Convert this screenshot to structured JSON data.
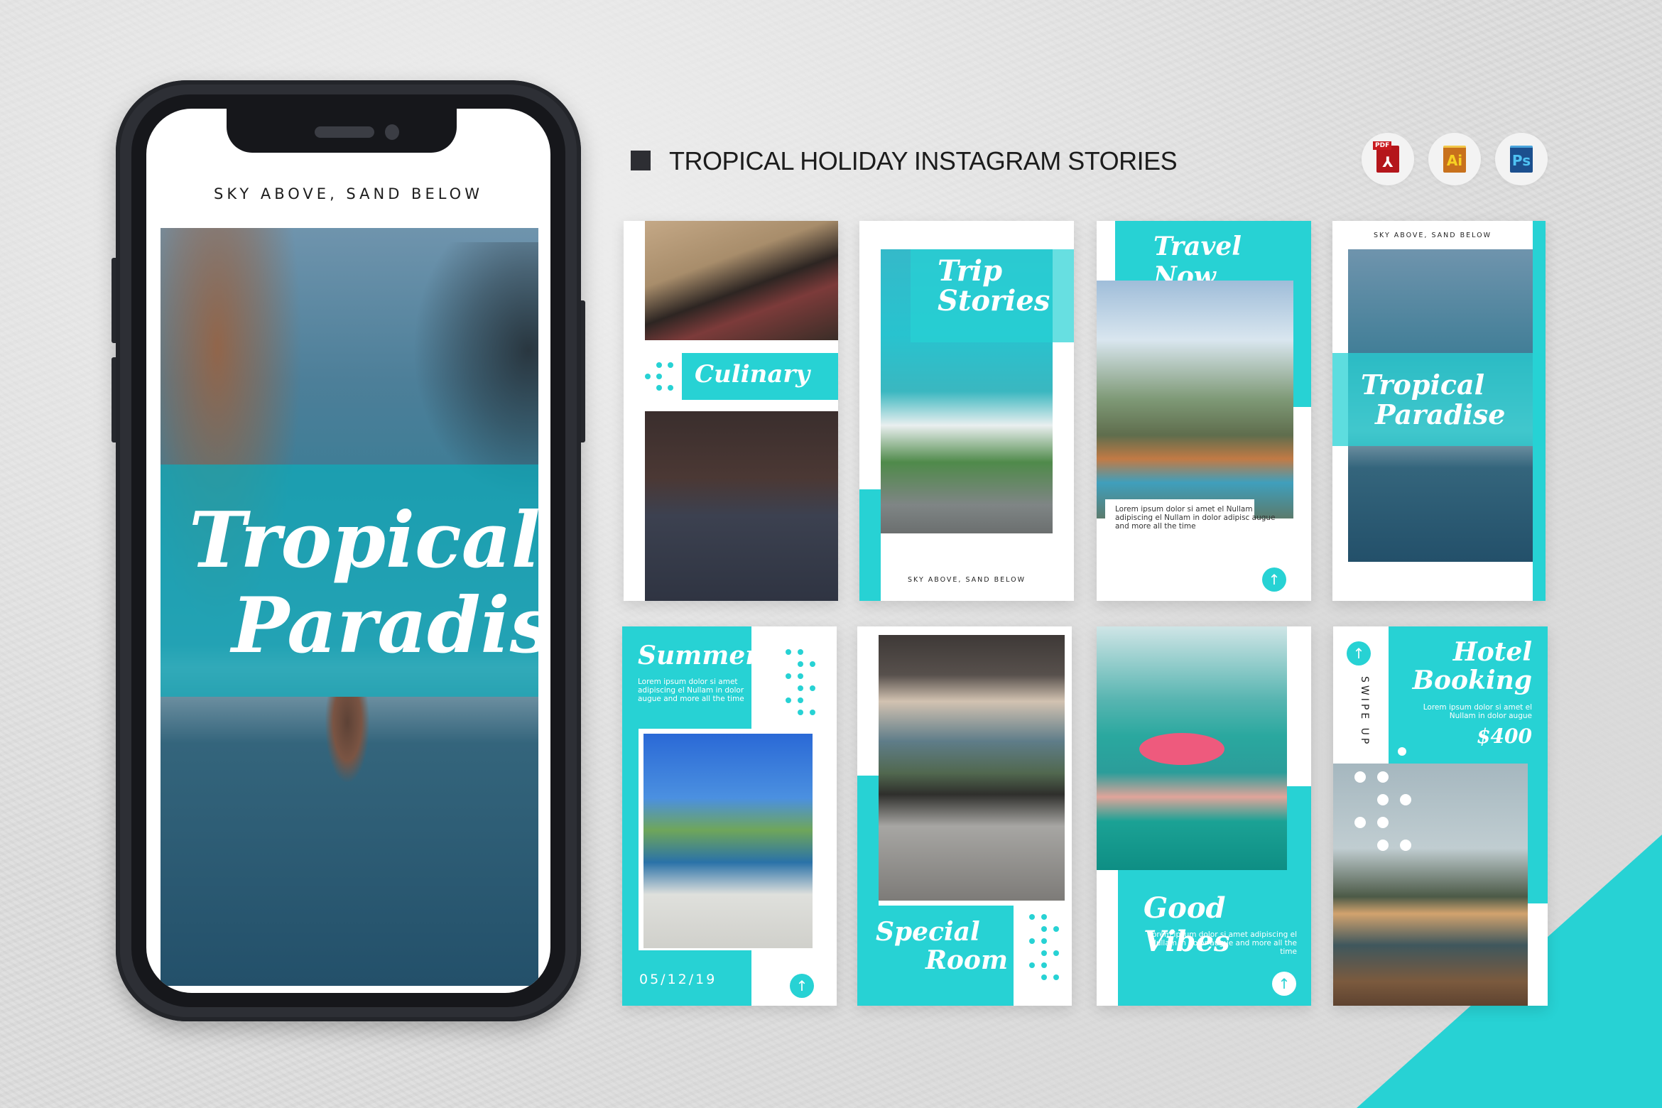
{
  "header": {
    "title": "TROPICAL HOLIDAY INSTAGRAM STORIES",
    "formats": [
      {
        "name": "pdf",
        "label": "PDF",
        "glyph": "⅄"
      },
      {
        "name": "illustrator",
        "label": "Ai"
      },
      {
        "name": "photoshop",
        "label": "Ps"
      }
    ]
  },
  "colors": {
    "accent": "#27d2d4",
    "phone_frame": "#2d2f35",
    "background": "#dedede"
  },
  "phone": {
    "caption": "SKY ABOVE, SAND BELOW",
    "title_line1": "Tropical",
    "title_line2": "Paradise"
  },
  "stories": [
    {
      "id": "culinary",
      "title": "Culinary"
    },
    {
      "id": "trip-stories",
      "title_line1": "Trip",
      "title_line2": "Stories",
      "caption": "SKY ABOVE, SAND BELOW"
    },
    {
      "id": "travel-now",
      "title": "Travel Now",
      "body": "Lorem ipsum dolor si amet el Nullam adipiscing el Nullam in dolor adipisc augue and more all the time",
      "button_icon": "↑"
    },
    {
      "id": "tropical-paradise",
      "caption": "SKY ABOVE, SAND BELOW",
      "title_line1": "Tropical",
      "title_line2": "Paradise"
    },
    {
      "id": "summer",
      "title": "Summer",
      "body": "Lorem ipsum dolor si amet adipiscing el Nullam in dolor augue and  more all the time",
      "date": "05/12/19",
      "button_icon": "↑"
    },
    {
      "id": "special-room",
      "title_line1": "Special",
      "title_line2": "Room"
    },
    {
      "id": "good-vibes",
      "title": "Good Vibes",
      "body": "Lorem ipsum dolor si amet adipiscing el Nullam in dolor augue and more all the time",
      "button_icon": "↑"
    },
    {
      "id": "hotel-booking",
      "title_line1": "Hotel",
      "title_line2": "Booking",
      "body": "Lorem ipsum dolor si amet el Nullam in dolor augue",
      "price": "$400",
      "swipe_label": "SWIPE UP",
      "button_icon": "↑"
    }
  ]
}
